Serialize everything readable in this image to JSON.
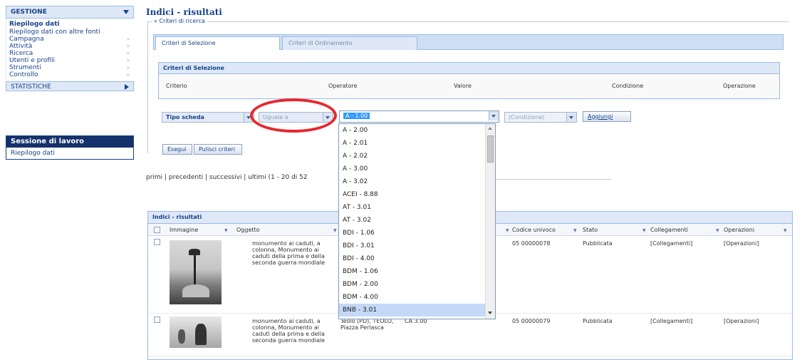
{
  "sidebar": {
    "header": "GESTIONE",
    "items": [
      {
        "label": "Riepilogo dati",
        "arrow": ""
      },
      {
        "label": "Riepilogo dati con altre fonti",
        "arrow": ""
      },
      {
        "label": "Campagna",
        "arrow": "»"
      },
      {
        "label": "Attività",
        "arrow": "»"
      },
      {
        "label": "Ricerca",
        "arrow": "»"
      },
      {
        "label": "Utenti e profili",
        "arrow": "»"
      },
      {
        "label": "Strumenti",
        "arrow": "»"
      },
      {
        "label": "Controllo",
        "arrow": "»"
      }
    ],
    "statistiche": "STATISTICHE"
  },
  "session": {
    "title": "Sessione di lavoro",
    "item": "Riepilogo dati"
  },
  "page": {
    "title": "Indici - risultati",
    "criteria_legend": "« Criteri di ricerca"
  },
  "tabs": {
    "selection": "Criteri di Selezione",
    "sorting": "Criteri di Ordinamento"
  },
  "selection_panel": {
    "title": "Criteri di Selezione",
    "columns": [
      "Criterio",
      "Operatore",
      "Valore",
      "Condizione",
      "Operazione"
    ]
  },
  "filter": {
    "type_value": "Tipo scheda",
    "operator_value": "Uguale a",
    "value_selected": "A - 1.00",
    "condition_value": "(Condizione)",
    "add_button": "Aggiungi"
  },
  "dropdown_options": [
    "A - 2.00",
    "A - 2.01",
    "A - 2.02",
    "A - 3.00",
    "A - 3.02",
    "ACEI - 8.88",
    "AT - 3.01",
    "AT - 3.02",
    "BDI - 1.06",
    "BDI - 3.01",
    "BDI - 4.00",
    "BDM - 1.06",
    "BDM - 2.00",
    "BDM - 4.00",
    "BNB - 3.01"
  ],
  "dropdown_highlight": "BNB - 3.01",
  "actions": {
    "search": "Esegui",
    "clear": "Pulisci criteri"
  },
  "pager": "primi | precedenti | successivi | ultimi (1 - 20 di 52",
  "grid": {
    "title": "Indici - risultati",
    "headers": [
      "Immagine",
      "Oggetto",
      "Codice univoco",
      "Stato",
      "Collegamenti",
      "Operazioni"
    ],
    "rows": [
      {
        "oggetto": "monumento ai caduti, a colonna, Monumento ai caduti della prima e della seconda guerra mondiale",
        "localizzazione": "",
        "versione": "",
        "codice": "05 00000078",
        "stato": "Pubblicata",
        "collegamenti": "[Collegamenti]",
        "operazioni": "[Operazioni]"
      },
      {
        "oggetto": "monumento ai caduti, a colonna, Monumento ai caduti della prima e della seconda guerra mondiale",
        "localizzazione": "Teolo (PD), TEOLO, Piazza Perlasca",
        "versione": "CA 3.00",
        "codice": "05 00000079",
        "stato": "Pubblicata",
        "collegamenti": "[Collegamenti]",
        "operazioni": "[Operazioni]"
      }
    ]
  },
  "colors": {
    "accent": "#15428b",
    "panel": "#dfe8f6",
    "border": "#99bbe8",
    "annotation": "#e8262d",
    "selection": "#3399ff"
  }
}
